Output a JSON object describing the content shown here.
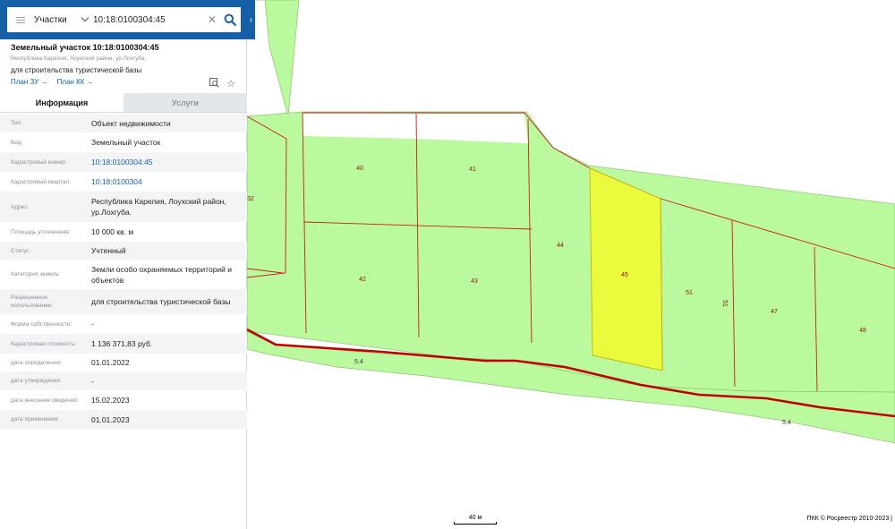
{
  "search": {
    "type": "Участки",
    "value": "10:18:0100304:45"
  },
  "object": {
    "title": "Земельный участок 10:18:0100304:45",
    "address": "Республика Карелия, Лоухский район, ур.Лохгуба.",
    "purpose": "для строительства туристической базы",
    "link_plan_zu": "План ЗУ →",
    "link_plan_kk": "План КК →"
  },
  "tabs": [
    {
      "label": "Информация",
      "active": true
    },
    {
      "label": "Услуги",
      "active": false
    }
  ],
  "rows": [
    {
      "label": "Тип:",
      "value": "Объект недвижимости",
      "link": false
    },
    {
      "label": "Вид:",
      "value": "Земельный участок",
      "link": false
    },
    {
      "label": "Кадастровый номер:",
      "value": "10:18:0100304:45",
      "link": true
    },
    {
      "label": "Кадастровый квартал:",
      "value": "10:18:0100304",
      "link": true
    },
    {
      "label": "Адрес:",
      "value": "Республика Карелия, Лоухский район, ур.Лохгуба.",
      "link": false
    },
    {
      "label": "Площадь уточненная:",
      "value": "10 000 кв. м",
      "link": false
    },
    {
      "label": "Статус:",
      "value": "Учтенный",
      "link": false
    },
    {
      "label": "Категория земель:",
      "value": "Земли особо охраняемых территорий и объектов",
      "link": false
    },
    {
      "label": "Разрешенное использование:",
      "value": "для строительства туристической базы",
      "link": false
    },
    {
      "label": "Форма собственности:",
      "value": "-",
      "link": false
    },
    {
      "label": "Кадастровая стоимость:",
      "value": "1 136 371,83 руб.",
      "link": false
    },
    {
      "label": "дата определения:",
      "value": "01.01.2022",
      "link": false
    },
    {
      "label": "дата утверждения:",
      "value": "-",
      "link": false
    },
    {
      "label": "дата внесения сведений:",
      "value": "15.02.2023",
      "link": false
    },
    {
      "label": "дата применения:",
      "value": "01.01.2023",
      "link": false
    }
  ],
  "map": {
    "plot_labels": [
      "32",
      "40",
      "41",
      "42",
      "43",
      "44",
      "45",
      "51",
      "51",
      "47",
      "48"
    ],
    "road_label": "5.4",
    "scale_label": "40 м",
    "copyright": "ПКК © Росреестр 2010-2023 |"
  },
  "colors": {
    "header_blue": "#1560a6",
    "parcel_green": "#bbf99e",
    "selected_parcel": "#e9fb3c",
    "boundary_red": "#c81e1e",
    "road_red": "#c00000"
  }
}
